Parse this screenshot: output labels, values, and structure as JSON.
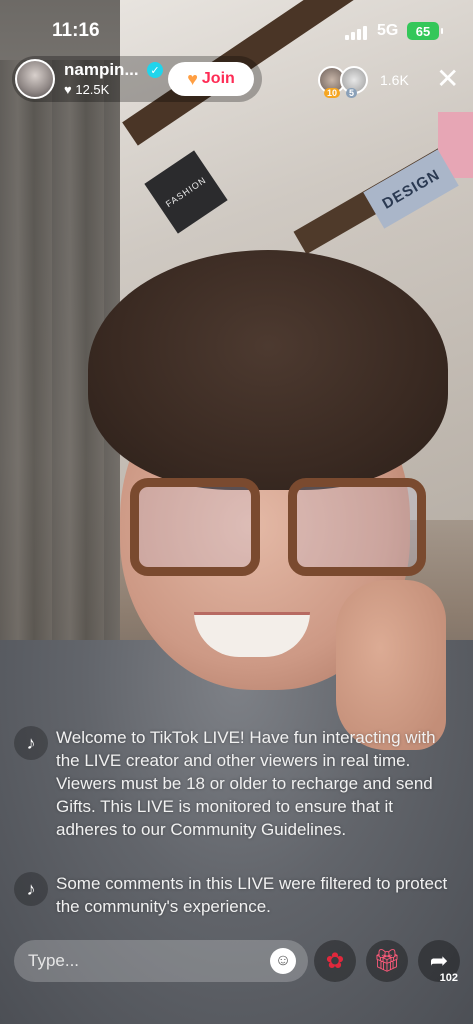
{
  "status_bar": {
    "time": "11:16",
    "network": "5G",
    "battery": "65"
  },
  "host": {
    "name": "nampin...",
    "likes": "12.5K",
    "join_label": "Join"
  },
  "viewers": {
    "badge_1": "10",
    "badge_2": "5",
    "count": "1.6K"
  },
  "background": {
    "book_1": "FASHION",
    "book_2": "DESIGN"
  },
  "comments": [
    {
      "text": "Welcome to TikTok LIVE! Have fun interacting with the LIVE creator and other viewers in real time. Viewers must be 18 or older to recharge and send Gifts. This LIVE is monitored to ensure that it adheres to our Community Guidelines."
    },
    {
      "text": "Some comments in this LIVE were filtered to protect the community's experience."
    }
  ],
  "bottom_bar": {
    "input_placeholder": "Type...",
    "share_count": "102"
  },
  "icons": {
    "comment_icon": "tiktok-logo-icon",
    "emoji": "emoji-icon",
    "rose": "rose-gift-icon",
    "gift": "gift-box-icon",
    "share": "share-arrow-icon",
    "close": "close-icon"
  },
  "colors": {
    "join_text": "#fe2c55",
    "verified": "#20d5ec",
    "battery": "#34c759"
  }
}
